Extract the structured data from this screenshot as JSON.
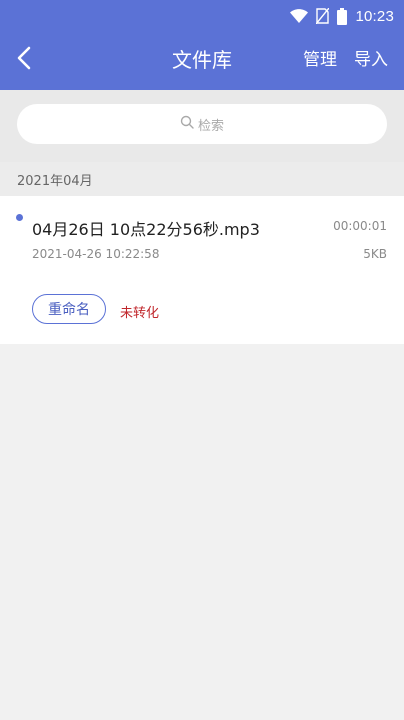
{
  "status_bar": {
    "time": "10:23",
    "icons": [
      "wifi-icon",
      "no-sim-icon",
      "battery-icon"
    ]
  },
  "header": {
    "back_icon": "back-arrow-icon",
    "title": "文件库",
    "manage_label": "管理",
    "import_label": "导入"
  },
  "search": {
    "icon": "search-icon",
    "placeholder": "检索"
  },
  "groups": [
    {
      "label": "2021年04月",
      "files": [
        {
          "name": "04月26日 10点22分56秒.mp3",
          "duration": "00:00:01",
          "datetime": "2021-04-26 10:22:58",
          "size": "5KB",
          "rename_label": "重命名",
          "status": "未转化"
        }
      ]
    }
  ],
  "colors": {
    "primary": "#5b72d6",
    "status_red": "#c0262b",
    "background": "#f1f1f1"
  }
}
